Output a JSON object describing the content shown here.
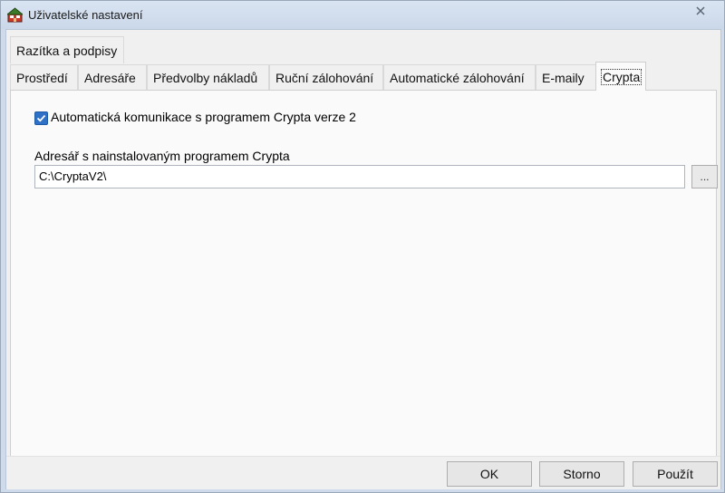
{
  "window": {
    "title": "Uživatelské nastavení",
    "app_icon": "app-house-icon",
    "close_icon": "close-icon"
  },
  "tabs": {
    "row1": [
      "Razítka a podpisy"
    ],
    "row2": [
      "Prostředí",
      "Adresáře",
      "Předvolby nákladů",
      "Ruční zálohování",
      "Automatické zálohování",
      "E-maily",
      "Crypta"
    ],
    "active": "Crypta"
  },
  "crypta": {
    "checkbox_label": "Automatická komunikace s programem Crypta verze 2",
    "checkbox_checked": true,
    "path_label": "Adresář s nainstalovaným programem Crypta",
    "path_value": "C:\\CryptaV2\\",
    "browse_label": "..."
  },
  "buttons": {
    "ok": "OK",
    "cancel": "Storno",
    "apply": "Použít"
  },
  "colors": {
    "accent": "#2f71c6",
    "title_bar": "#cfdbea"
  }
}
